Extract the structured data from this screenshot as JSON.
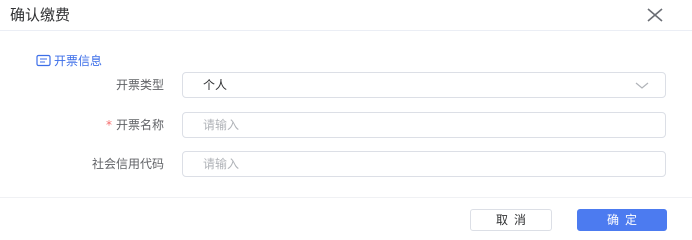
{
  "dialog": {
    "title": "确认缴费",
    "close_icon": "close-icon"
  },
  "section": {
    "title": "开票信息",
    "icon": "invoice-icon"
  },
  "form": {
    "invoice_type": {
      "label": "开票类型",
      "value": "个人",
      "icon": "chevron-down-icon"
    },
    "invoice_name": {
      "required_mark": "*",
      "label": "开票名称",
      "placeholder": "请输入"
    },
    "credit_code": {
      "label": "社会信用代码",
      "placeholder": "请输入"
    }
  },
  "buttons": {
    "cancel": "取消",
    "confirm": "确定"
  },
  "colors": {
    "accent": "#3c6ee8",
    "primary_button": "#4c7bf0",
    "required": "#f56c6c",
    "border": "#dcdfe6"
  }
}
